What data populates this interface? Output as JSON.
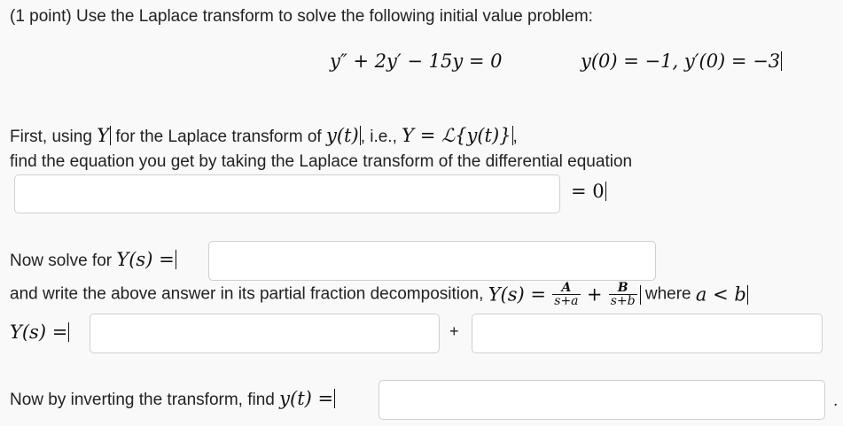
{
  "problem": {
    "intro": "(1 point) Use the Laplace transform to solve the following initial value problem:",
    "ode": "y″ + 2y′ − 15y = 0",
    "initial_conditions": "y(0) = −1,  y′(0) = −3"
  },
  "part1": {
    "text_start": "First, using ",
    "Y_symbol": "Y",
    "text_mid": " for the Laplace transform of ",
    "y_of_t": "y(t)",
    "text_ie": ", i.e., ",
    "def_eq": "Y = ℒ{y(t)}",
    "line2": "find the equation you get by taking the Laplace transform of the differential equation",
    "equals_zero": "= 0",
    "answer_value": ""
  },
  "part2": {
    "label_text": "Now solve for ",
    "label_math": "Y(s) =",
    "answer_value": ""
  },
  "part3": {
    "text": "and write the above answer in its partial fraction decomposition, ",
    "Ys_eq": "Y(s) =",
    "frac1_num": "A",
    "frac1_den": "s+a",
    "plus": "+",
    "frac2_num": "B",
    "frac2_den": "s+b",
    "where_text": "where ",
    "condition": "a < b",
    "row_label": "Y(s) =",
    "row_plus": "+",
    "answer_A": "",
    "answer_B": ""
  },
  "part4": {
    "label_text": "Now by inverting the transform, find ",
    "label_math": "y(t) =",
    "trailing": ".",
    "answer_value": ""
  }
}
